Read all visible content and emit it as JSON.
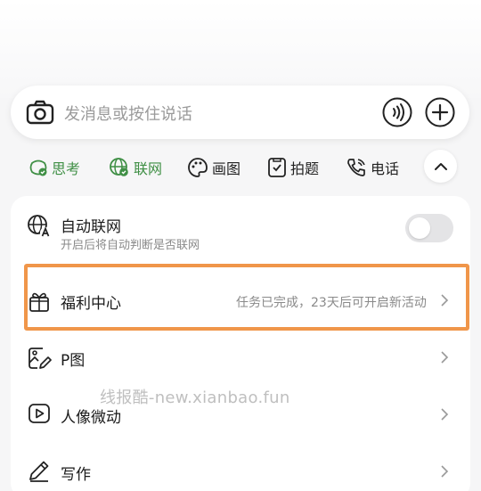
{
  "input": {
    "placeholder": "发消息或按住说话"
  },
  "chips": [
    {
      "label": "思考",
      "icon": "think-icon"
    },
    {
      "label": "联网",
      "icon": "globe-icon"
    },
    {
      "label": "画图",
      "icon": "palette-icon"
    },
    {
      "label": "拍题",
      "icon": "photo-question-icon"
    },
    {
      "label": "电话",
      "icon": "phone-icon"
    }
  ],
  "menu": {
    "auto_net": {
      "title": "自动联网",
      "subtitle": "开启后将自动判断是否联网",
      "enabled": false
    },
    "welfare": {
      "title": "福利中心",
      "status": "任务已完成，23天后可开启新活动"
    },
    "p_image": {
      "title": "P图"
    },
    "portrait": {
      "title": "人像微动"
    },
    "writing": {
      "title": "写作"
    }
  },
  "watermark": "线报酷-new.xianbao.fun",
  "colors": {
    "accent_green": "#3f8f45",
    "highlight_orange": "#f0964a"
  }
}
